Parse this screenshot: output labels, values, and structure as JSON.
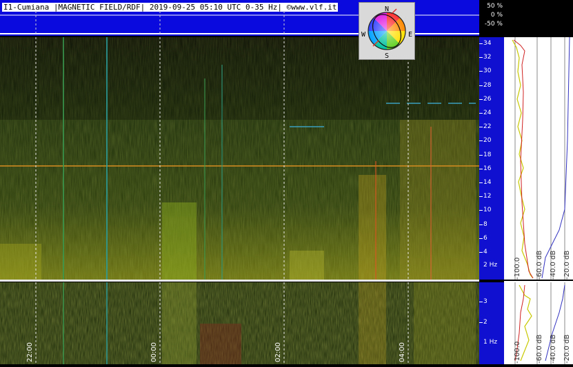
{
  "header": {
    "title": "I1-Cumiana |MAGNETIC FIELD/RDF| 2019-09-25 05:10 UTC 0-35 Hz| ©www.vlf.it",
    "percent_labels": [
      "50 %",
      "0 %",
      "-50 %"
    ]
  },
  "compass": {
    "n": "N",
    "s": "S",
    "e": "E",
    "w": "W"
  },
  "time_labels": [
    "22:00",
    "00:00",
    "02:00",
    "04:00"
  ],
  "freq_axis_top": {
    "labels": [
      "34",
      "32",
      "30",
      "28",
      "26",
      "24",
      "22",
      "20",
      "18",
      "16",
      "14",
      "12",
      "10",
      "8",
      "6",
      "4"
    ],
    "unit_label": "2 Hz"
  },
  "freq_axis_bottom": {
    "labels": [
      "3",
      "2"
    ],
    "unit_label": "1 Hz"
  },
  "profile_top": {
    "db_labels": [
      "-100.0",
      "-60.0 dB",
      "-40.0 dB",
      "-20.0 dB"
    ]
  },
  "profile_bottom": {
    "db_labels": [
      "-100.0",
      "-60.0 dB",
      "-40.0 dB",
      "-20.0 dB"
    ]
  },
  "colors": {
    "header_bg": "#0a0adf",
    "axis_bg": "#1010d0",
    "profile_bg": "#ffffff"
  }
}
